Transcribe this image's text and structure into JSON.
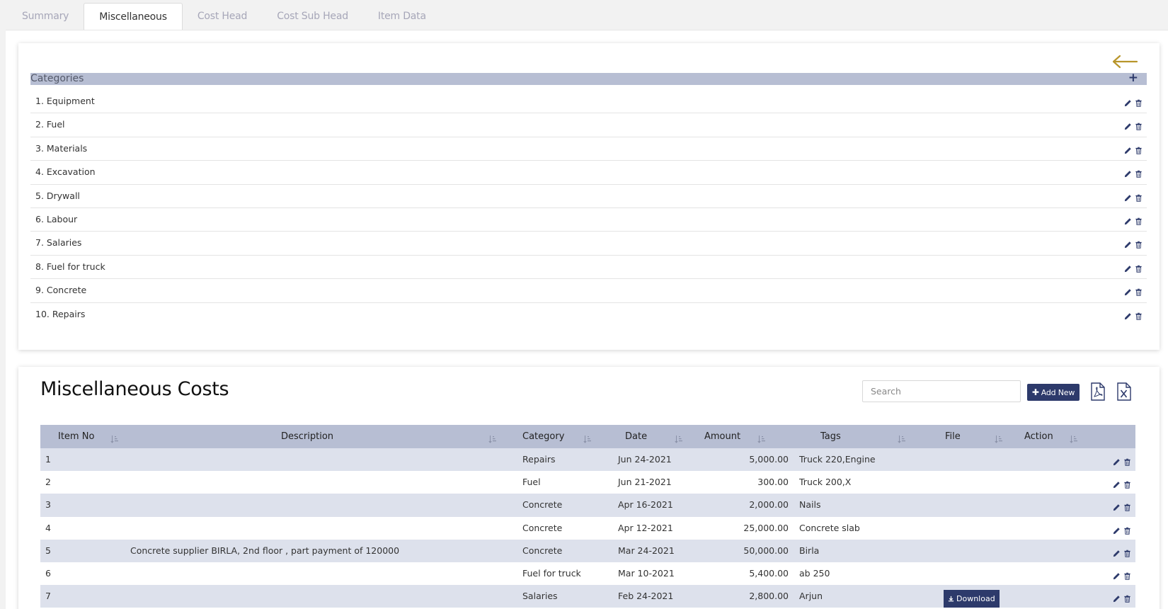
{
  "tabs": [
    {
      "label": "Summary",
      "active": false
    },
    {
      "label": "Miscellaneous",
      "active": true
    },
    {
      "label": "Cost Head",
      "active": false
    },
    {
      "label": "Cost Sub Head",
      "active": false
    },
    {
      "label": "Item Data",
      "active": false
    }
  ],
  "categories": {
    "title": "Categories",
    "add_icon": "plus-icon",
    "back_icon": "arrow-left-icon",
    "items": [
      {
        "label": "1. Equipment"
      },
      {
        "label": "2. Fuel"
      },
      {
        "label": "3. Materials"
      },
      {
        "label": "4. Excavation"
      },
      {
        "label": "5. Drywall"
      },
      {
        "label": "6. Labour"
      },
      {
        "label": "7. Salaries"
      },
      {
        "label": "8. Fuel for truck"
      },
      {
        "label": "9. Concrete"
      },
      {
        "label": "10. Repairs"
      }
    ]
  },
  "misc": {
    "title": "Miscellaneous Costs",
    "search_placeholder": "Search",
    "search_value": "",
    "add_new_label": "Add New",
    "download_label": "Download",
    "columns": [
      "Item No",
      "Description",
      "Category",
      "Date",
      "Amount",
      "Tags",
      "File",
      "Action"
    ],
    "rows": [
      {
        "item_no": "1",
        "description": "",
        "category": "Repairs",
        "date": "Jun 24-2021",
        "amount": "5,000.00",
        "tags": "Truck 220,Engine",
        "has_file": false
      },
      {
        "item_no": "2",
        "description": "",
        "category": "Fuel",
        "date": "Jun 21-2021",
        "amount": "300.00",
        "tags": "Truck 200,X",
        "has_file": false
      },
      {
        "item_no": "3",
        "description": "",
        "category": "Concrete",
        "date": "Apr 16-2021",
        "amount": "2,000.00",
        "tags": "Nails",
        "has_file": false
      },
      {
        "item_no": "4",
        "description": "",
        "category": "Concrete",
        "date": "Apr 12-2021",
        "amount": "25,000.00",
        "tags": "Concrete slab",
        "has_file": false
      },
      {
        "item_no": "5",
        "description": "Concrete supplier BIRLA, 2nd floor , part payment of 120000",
        "category": "Concrete",
        "date": "Mar 24-2021",
        "amount": "50,000.00",
        "tags": "Birla",
        "has_file": false
      },
      {
        "item_no": "6",
        "description": "",
        "category": "Fuel for truck",
        "date": "Mar 10-2021",
        "amount": "5,400.00",
        "tags": "ab 250",
        "has_file": false
      },
      {
        "item_no": "7",
        "description": "",
        "category": "Salaries",
        "date": "Feb 24-2021",
        "amount": "2,800.00",
        "tags": "Arjun",
        "has_file": true
      }
    ]
  },
  "colors": {
    "accent": "#2d3a6b",
    "header_bg": "#b7bed3",
    "stripe": "#dde1ec",
    "back_arrow": "#b8952a"
  }
}
